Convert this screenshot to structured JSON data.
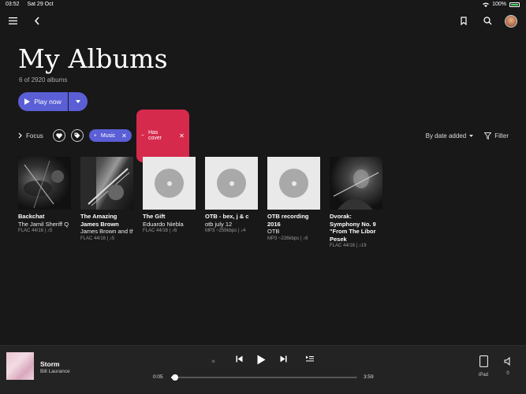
{
  "status": {
    "time": "03:52",
    "date": "Sat 29 Oct",
    "battery": "100%"
  },
  "icons": {
    "menu": "menu-icon",
    "back": "back-arrow-icon",
    "bookmark": "bookmark-icon",
    "search": "search-icon",
    "heart": "heart-icon",
    "tag": "tag-icon",
    "filter": "filter-icon",
    "play": "play-icon",
    "prev": "skip-previous-icon",
    "next": "skip-next-icon",
    "queue": "queue-icon",
    "ipad": "ipad-icon",
    "volume": "volume-icon"
  },
  "header": {
    "title": "My Albums",
    "subtitle": "6 of 2920 albums"
  },
  "actions": {
    "play_now": "Play now"
  },
  "filters": {
    "focus": "Focus",
    "chips": [
      {
        "label": "Music",
        "color": "#5a5fd6",
        "sign": "+"
      },
      {
        "label": "Has cover",
        "color": "#d62a4d",
        "sign": "−"
      }
    ],
    "sort": "By date added",
    "filter": "Filter"
  },
  "albums": [
    {
      "title": "Backchat",
      "artist": "The Jamil Sheriff Q",
      "meta": "FLAC 44/16 | ♪5",
      "cover": "photo"
    },
    {
      "title": "The Amazing James Brown",
      "artist": "James Brown and th",
      "meta": "FLAC 44/16 | ♪5",
      "cover": "photo"
    },
    {
      "title": "The Gift",
      "artist": "Eduardo Niebla",
      "meta": "FLAC 44/16 | ♪6",
      "cover": "placeholder"
    },
    {
      "title": "OTB - bex, j & c",
      "artist": "otb july 12",
      "meta": "MP3 ~259kbps | ♪4",
      "cover": "placeholder"
    },
    {
      "title": "OTB recording 2016",
      "artist": "OTB",
      "meta": "MP3 ~226kbps | ♪6",
      "cover": "placeholder"
    },
    {
      "title": "Dvorak: Symphony No. 9 \"From The Libor Pesek",
      "artist": "",
      "meta": "FLAC 44/16 | ♪19",
      "cover": "photo"
    }
  ],
  "player": {
    "title": "Storm",
    "artist": "Bill Laurance",
    "elapsed": "0:05",
    "duration": "3:59",
    "progress": 0.021,
    "device": "iPad",
    "volume": "0"
  },
  "colors": {
    "accent": "#5a5fd6",
    "danger": "#d62a4d",
    "background": "#181818"
  }
}
